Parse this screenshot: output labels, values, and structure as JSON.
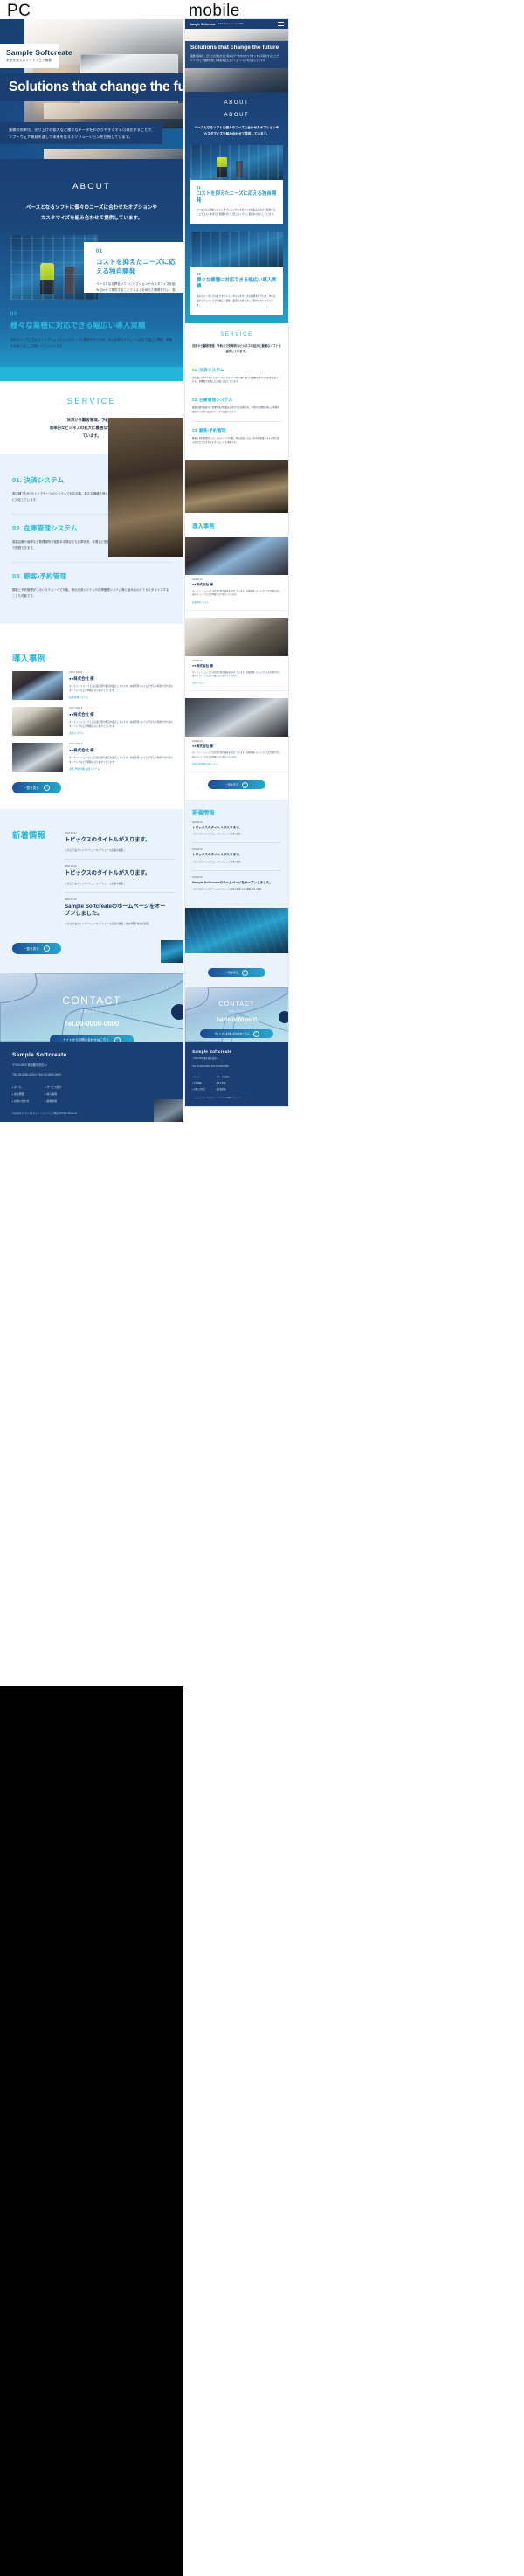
{
  "labels": {
    "pc": "PC",
    "mobile": "mobile"
  },
  "brand": {
    "name": "Sample Softcreate",
    "tagline": "未来を変えるソフトウェア開発"
  },
  "hero": {
    "title": "Solutions that change the future",
    "subtitle": "業務の効率化、売り上げの拡大など様々なデータをわかりやすくする可視化することで、ソフトウェア開発を通して未来を変えるソリューションを目指しています。",
    "mobile_title": "Solutions that change the future",
    "mobile_subtitle": "業務の効率化、売り上げの拡大など様々なデータをわかりやすくする可視化することで、ソフトウェア開発を通して未来を変えるソリューションを目指しています。"
  },
  "about": {
    "heading": "ABOUT",
    "lead": "ベースとなるソフトに個々のニーズに合わせたオプションや\nカスタマイズを組み合わせて提供しています。",
    "lead_line1": "ベースとなるソフトに個々のニーズに合わせたオプションや",
    "lead_line2": "カスタマイズを組み合わせて提供しています。",
    "mobile_lead": "ベースとなるソフトに個々のニーズに合わせたオプションやカスタマイズを組み合わせて提供しています。",
    "cards": [
      {
        "num": "01",
        "title": "コストを抑えたニーズに応える独自開発",
        "text": "ベースとなる弊社ソフトにオプションやカスタマイズを組み合わせて提供することでコストを抑えた開発を行い、低コストでのご提供を可能にしています。",
        "image": "warehouse-workers-photo"
      },
      {
        "num": "02",
        "title": "様々な業種に対応できる幅広い導入実績",
        "text": "個々のニーズに合わせてオプションやカスタマイズの開発を行うため、中小企業からチェーン店まで幅広い業種、業態のお客さまにご利用いただいています。",
        "image": "documents-hand-photo"
      }
    ]
  },
  "service": {
    "heading": "SERVICE",
    "lead_line1": "決済から顧客管理、予約まで",
    "lead_line2": "効率的なビジネスの拡大に最適なソフトを提供し",
    "lead_line3": "ています。",
    "mobile_lead": "決済から顧客管理、予約まで効率的なビジネスの拡大に最適なソフトを提供しています。",
    "items": [
      {
        "title": "01. 決済システム",
        "text": "実店舗でもECサイトでも一つのシステムで対応可能。新たな機器を導入する必要はありません。各種電子決済にも迅速に対応しています。"
      },
      {
        "title": "02. 在庫管理システム",
        "text": "複数店舗や倉庫など管理場所が複数ある場合でも在庫状況、年間など期間の他にも季節や曜日での在庫の変動がデータで確認できます。"
      },
      {
        "title": "03. 顧客・予約管理",
        "text": "顧客と予約管理がこのシステム一つで可能。他の決済システムや在庫管理システム等と組み合わせてカスタマイズすることも可能です。"
      }
    ]
  },
  "cases": {
    "heading": "導入事例",
    "button": "一覧を見る",
    "items": [
      {
        "date": "2022.09.20",
        "company": "●●株式会社 様",
        "text": "オンラインショップと実店舗で服や雑貨を販売しています。在庫管理システムで仕入れ時期や売れ筋のタイミングなどが明確になり助かっています。",
        "tag": "在庫管理システム",
        "image": "tablet-pos-photo"
      },
      {
        "date": "2022.09.20",
        "company": "●●株式会社 様",
        "text": "オンラインショップと実店舗で服や雑貨を販売しています。在庫管理システムで仕入れ時期や売れ筋のタイミングなどが明確になり助かっています。",
        "tag": "決済システム",
        "image": "credit-card-laptop-photo"
      },
      {
        "date": "2022.09.19",
        "company": "●●株式会社 様",
        "text": "オンラインショップと実店舗で服や雑貨を販売しています。在庫管理システムで仕入れ時期や売れ筋のタイミングなどが明確になり助かっています。",
        "tag": "決済・予約管理・在庫システム",
        "image": "mobile-payment-photo"
      }
    ]
  },
  "news": {
    "heading": "新着情報",
    "button": "一覧を見る",
    "items": [
      {
        "date": "2022.09.22",
        "title": "トピックスのタイトルが入ります。",
        "desc": "この上で右クリック・「ニュース」・「ニュース記事の編集」"
      },
      {
        "date": "2022.09.20",
        "title": "トピックスのタイトルが入ります。",
        "desc": "この上で右クリック・「ニュース」・「ニュース記事の編集」"
      },
      {
        "date": "2022.09.20",
        "title": "Sample Softcreateのホームページをオープンしました。",
        "desc": "この上で右クリック・「ニュース」・「ニュース記事の編集」・日付・概要・本文の編集"
      }
    ]
  },
  "contact": {
    "title": "CONTACT",
    "subtitle": "お問い合わせ",
    "tel_label": "Tel.",
    "tel": "00-0000-0000",
    "tel_full": "Tel.00-0000-0000",
    "button": "サイトからお問い合わせはこちら"
  },
  "footer": {
    "name": "Sample Softcreate",
    "address": "〒000-0000 東京都中央区・・・",
    "phone": "TEL 00-0000-0000 / FAX 00-0000-0000",
    "links_col1": [
      "ホーム",
      "会社概要",
      "お問い合わせ"
    ],
    "links_col2": [
      "サービス紹介",
      "導入事例",
      "新着情報"
    ],
    "copyright": "Copyright (c) サンプルサイト｜ソフトウェア開発 All Rights Reserved."
  },
  "colors": {
    "navy": "#1b3f73",
    "cyan": "#2fb8dd",
    "blue": "#2a9ad0",
    "panel": "#eaf3fb"
  }
}
